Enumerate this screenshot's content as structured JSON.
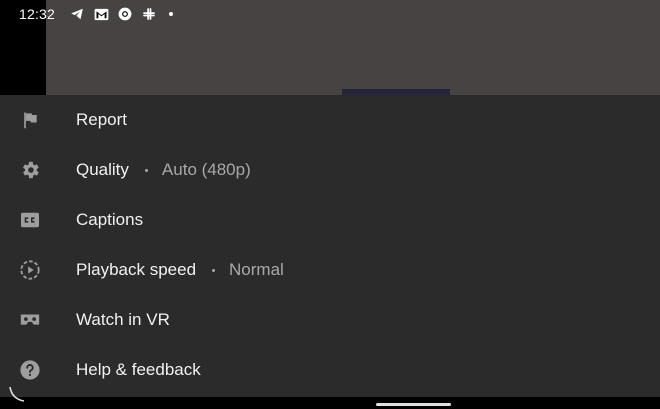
{
  "status_bar": {
    "time": "12:32",
    "icons": [
      "telegram-icon",
      "gmail-icon",
      "chrome-icon",
      "slack-icon",
      "more-notifications-dot"
    ]
  },
  "menu": {
    "items": [
      {
        "label": "Report",
        "icon": "flag-icon"
      },
      {
        "label": "Quality",
        "sub": "Auto (480p)",
        "icon": "gear-icon"
      },
      {
        "label": "Captions",
        "icon": "closed-captions-icon"
      },
      {
        "label": "Playback speed",
        "sub": "Normal",
        "icon": "playback-speed-icon"
      },
      {
        "label": "Watch in VR",
        "icon": "vr-headset-icon"
      },
      {
        "label": "Help & feedback",
        "icon": "help-icon"
      }
    ]
  },
  "colors": {
    "sheet_bg": "#2b2b2b",
    "text_primary": "#f1f1f1",
    "text_secondary": "#a8a8a8",
    "icon": "#9e9e9e"
  }
}
